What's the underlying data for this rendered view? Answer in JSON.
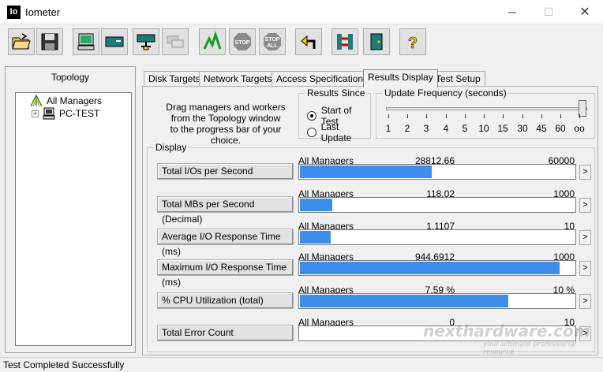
{
  "window": {
    "title": "Iometer",
    "icon_text": "Io"
  },
  "toolbar": {
    "buttons": [
      "open-icon",
      "save-icon",
      "new-worker-icon",
      "disk-worker-icon",
      "network-worker-icon",
      "duplicate-worker-icon",
      "start-icon",
      "stop-icon",
      "stop-all-icon",
      "reset-icon",
      "exit-icon",
      "exit-door-icon",
      "help-icon"
    ],
    "stop_label": "STOP",
    "stop_all_label_1": "STOP",
    "stop_all_label_2": "ALL",
    "help_label": "?"
  },
  "topology": {
    "title": "Topology",
    "root": "All Managers",
    "child": "PC-TEST",
    "expander": "+"
  },
  "tabs": [
    "Disk Targets",
    "Network Targets",
    "Access Specifications",
    "Results Display",
    "Test Setup"
  ],
  "active_tab": "Results Display",
  "drag_text": [
    "Drag managers and workers",
    "from the Topology window",
    "to the progress bar of your choice."
  ],
  "results_since": {
    "legend": "Results Since",
    "options": [
      "Start of Test",
      "Last Update"
    ],
    "selected": "Start of Test"
  },
  "update_frequency": {
    "legend": "Update Frequency (seconds)",
    "ticks": [
      "1",
      "2",
      "3",
      "4",
      "5",
      "10",
      "15",
      "30",
      "45",
      "60",
      "oo"
    ],
    "selected": "oo"
  },
  "display": {
    "legend": "Display",
    "more_label": ">",
    "rows": [
      {
        "label": "Total I/Os per Second",
        "source": "All Managers",
        "value": "28812.66",
        "max": "60000",
        "fraction": 0.4802
      },
      {
        "label": "Total MBs per Second (Decimal)",
        "source": "All Managers",
        "value": "118.02",
        "max": "1000",
        "fraction": 0.118
      },
      {
        "label": "Average I/O Response Time (ms)",
        "source": "All Managers",
        "value": "1.1107",
        "max": "10",
        "fraction": 0.111
      },
      {
        "label": "Maximum I/O Response Time (ms)",
        "source": "All Managers",
        "value": "944.6912",
        "max": "1000",
        "fraction": 0.9447
      },
      {
        "label": "% CPU Utilization (total)",
        "source": "All Managers",
        "value": "7.59 %",
        "max": "10 %",
        "fraction": 0.759
      },
      {
        "label": "Total Error Count",
        "source": "All Managers",
        "value": "0",
        "max": "10",
        "fraction": 0
      }
    ]
  },
  "status": {
    "text": "Test Completed Successfully"
  },
  "watermark": {
    "brand": "nexthardware.com",
    "tagline": "your ultimate professional resource"
  },
  "colors": {
    "bar": "#3c8ee8",
    "start_green": "#1a9a1a",
    "stop_grey": "#8a8a8a",
    "help_yellow": "#f3d400"
  }
}
